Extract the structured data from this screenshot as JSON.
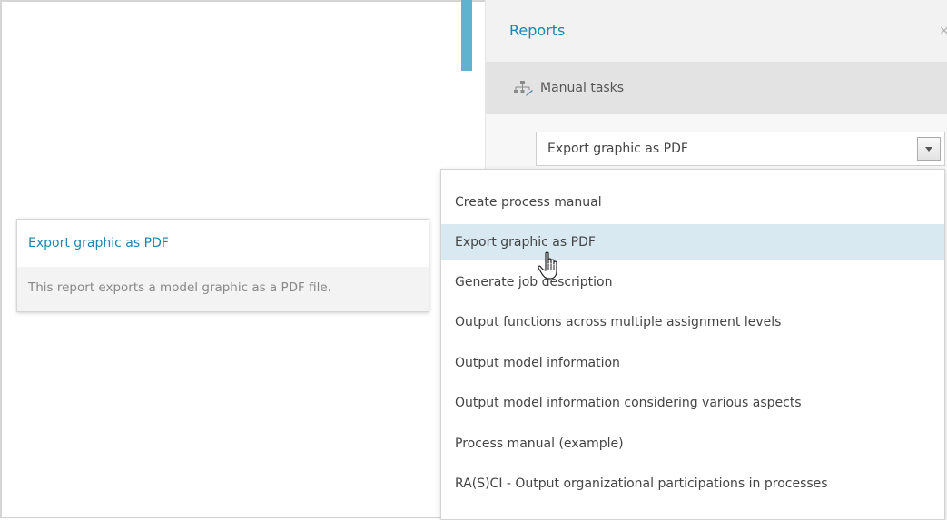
{
  "panel": {
    "title": "Reports",
    "close_icon": "×",
    "section": {
      "icon": "workflow-icon",
      "label": "Manual tasks"
    }
  },
  "select": {
    "value": "Export graphic as PDF",
    "button_icon": "chevron-down-icon"
  },
  "dropdown": {
    "items": [
      {
        "label": "Create process manual"
      },
      {
        "label": "Export graphic as PDF"
      },
      {
        "label": "Generate job description"
      },
      {
        "label": "Output functions across multiple assignment levels"
      },
      {
        "label": "Output model information"
      },
      {
        "label": "Output model information considering various aspects"
      },
      {
        "label": "Process manual (example)"
      },
      {
        "label": "RA(S)CI - Output organizational participations in processes"
      }
    ],
    "highlighted_item": "Export graphic as PDF"
  },
  "tooltip": {
    "title": "Export graphic as PDF",
    "description": "This report exports a model graphic as a PDF file."
  },
  "colors": {
    "accent": "#5fb3cf",
    "link": "#1a86b3",
    "highlight": "#d8e9f2"
  },
  "cursor": {
    "icon": "hand-pointer-icon"
  }
}
